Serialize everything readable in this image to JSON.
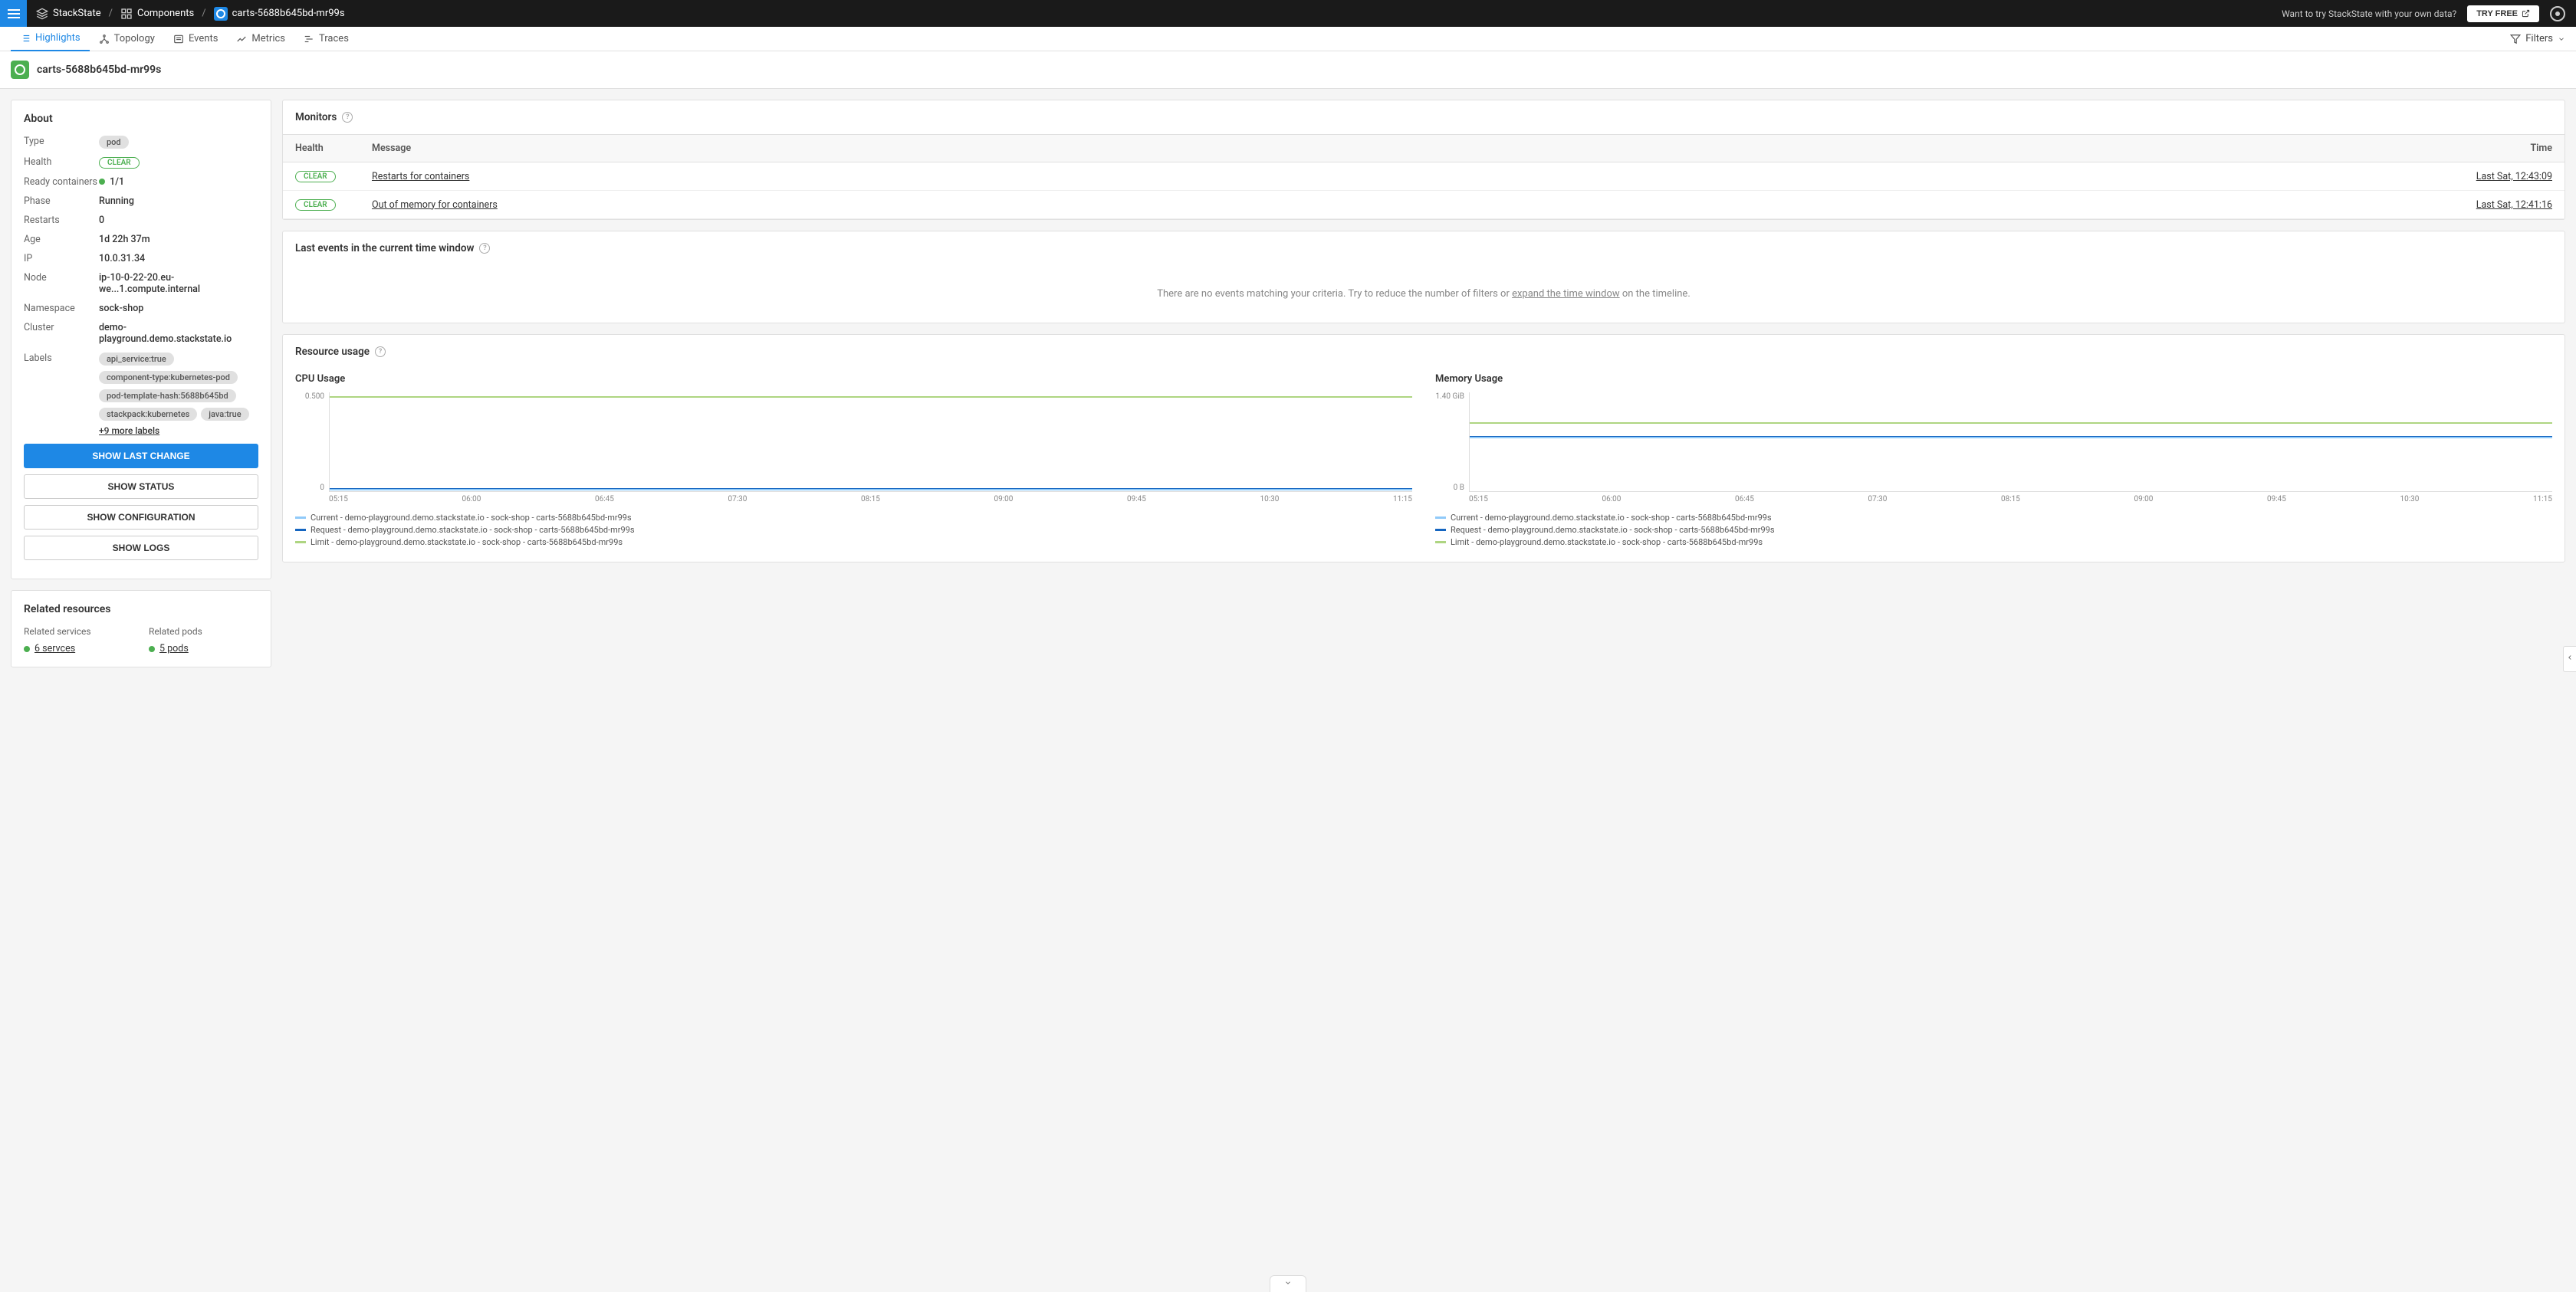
{
  "breadcrumb": {
    "root": "StackState",
    "mid": "Components",
    "leaf": "carts-5688b645bd-mr99s"
  },
  "topbar": {
    "try_text": "Want to try StackState with your own data?",
    "try_btn": "TRY FREE"
  },
  "tabs": {
    "highlights": "Highlights",
    "topology": "Topology",
    "events": "Events",
    "metrics": "Metrics",
    "traces": "Traces",
    "filters": "Filters"
  },
  "page_title": "carts-5688b645bd-mr99s",
  "about": {
    "heading": "About",
    "type_k": "Type",
    "type_v": "pod",
    "health_k": "Health",
    "health_v": "CLEAR",
    "ready_k": "Ready containers",
    "ready_v": "1/1",
    "phase_k": "Phase",
    "phase_v": "Running",
    "restarts_k": "Restarts",
    "restarts_v": "0",
    "age_k": "Age",
    "age_v": "1d 22h 37m",
    "ip_k": "IP",
    "ip_v": "10.0.31.34",
    "node_k": "Node",
    "node_v": "ip-10-0-22-20.eu-we...1.compute.internal",
    "ns_k": "Namespace",
    "ns_v": "sock-shop",
    "cluster_k": "Cluster",
    "cluster_v": "demo-playground.demo.stackstate.io",
    "labels_k": "Labels",
    "labels": {
      "l0": "api_service:true",
      "l1": "component-type:kubernetes-pod",
      "l2": "pod-template-hash:5688b645bd",
      "l3": "stackpack:kubernetes",
      "l4": "java:true",
      "more": "+9 more labels"
    },
    "btn_primary": "SHOW LAST CHANGE",
    "btn_status": "SHOW STATUS",
    "btn_config": "SHOW CONFIGURATION",
    "btn_logs": "SHOW LOGS"
  },
  "related": {
    "heading": "Related resources",
    "services_k": "Related services",
    "services_v": "6 servces",
    "pods_k": "Related pods",
    "pods_v": "5 pods"
  },
  "monitors": {
    "heading": "Monitors",
    "th_health": "Health",
    "th_msg": "Message",
    "th_time": "Time",
    "row1_health": "CLEAR",
    "row1_msg": "Restarts for containers",
    "row1_time": "Last Sat, 12:43:09",
    "row2_health": "CLEAR",
    "row2_msg": "Out of memory for containers",
    "row2_time": "Last Sat, 12:41:16"
  },
  "events": {
    "heading": "Last events in the current time window",
    "empty1": "There are no events matching your criteria. Try to reduce the number of filters or ",
    "empty_link": "expand the time window",
    "empty2": " on the timeline."
  },
  "resource": {
    "heading": "Resource usage",
    "cpu_title": "CPU Usage",
    "mem_title": "Memory Usage",
    "legend_current": "Current - demo-playground.demo.stackstate.io - sock-shop - carts-5688b645bd-mr99s",
    "legend_request": "Request - demo-playground.demo.stackstate.io - sock-shop - carts-5688b645bd-mr99s",
    "legend_limit": "Limit - demo-playground.demo.stackstate.io - sock-shop - carts-5688b645bd-mr99s"
  },
  "chart_data": [
    {
      "type": "line",
      "title": "CPU Usage",
      "xlabel": "",
      "ylabel": "",
      "ylim": [
        0,
        0.5
      ],
      "yticks": [
        "0.500",
        "0"
      ],
      "x": [
        "05:15",
        "06:00",
        "06:45",
        "07:30",
        "08:15",
        "09:00",
        "09:45",
        "10:30",
        "11:15"
      ],
      "series": [
        {
          "name": "Current",
          "color": "#90caf9",
          "values": [
            0.01,
            0.01,
            0.01,
            0.01,
            0.01,
            0.01,
            0.01,
            0.01,
            0.01
          ]
        },
        {
          "name": "Request",
          "color": "#1565c0",
          "values": [
            0.01,
            0.01,
            0.01,
            0.01,
            0.01,
            0.01,
            0.01,
            0.01,
            0.01
          ]
        },
        {
          "name": "Limit",
          "color": "#aed581",
          "values": [
            0.48,
            0.48,
            0.48,
            0.48,
            0.48,
            0.48,
            0.48,
            0.48,
            0.48
          ]
        }
      ]
    },
    {
      "type": "line",
      "title": "Memory Usage",
      "xlabel": "",
      "ylabel": "",
      "ylim": [
        0,
        1.4
      ],
      "yticks": [
        "1.40 GiB",
        "0 B"
      ],
      "x": [
        "05:15",
        "06:00",
        "06:45",
        "07:30",
        "08:15",
        "09:00",
        "09:45",
        "10:30",
        "11:15"
      ],
      "series": [
        {
          "name": "Current",
          "color": "#90caf9",
          "values": [
            0.78,
            0.78,
            0.78,
            0.78,
            0.78,
            0.78,
            0.78,
            0.78,
            0.78
          ]
        },
        {
          "name": "Request",
          "color": "#1565c0",
          "values": [
            0.78,
            0.78,
            0.78,
            0.78,
            0.78,
            0.78,
            0.78,
            0.78,
            0.78
          ]
        },
        {
          "name": "Limit",
          "color": "#aed581",
          "values": [
            0.98,
            0.98,
            0.98,
            0.98,
            0.98,
            0.98,
            0.98,
            0.98,
            0.98
          ]
        }
      ]
    }
  ]
}
